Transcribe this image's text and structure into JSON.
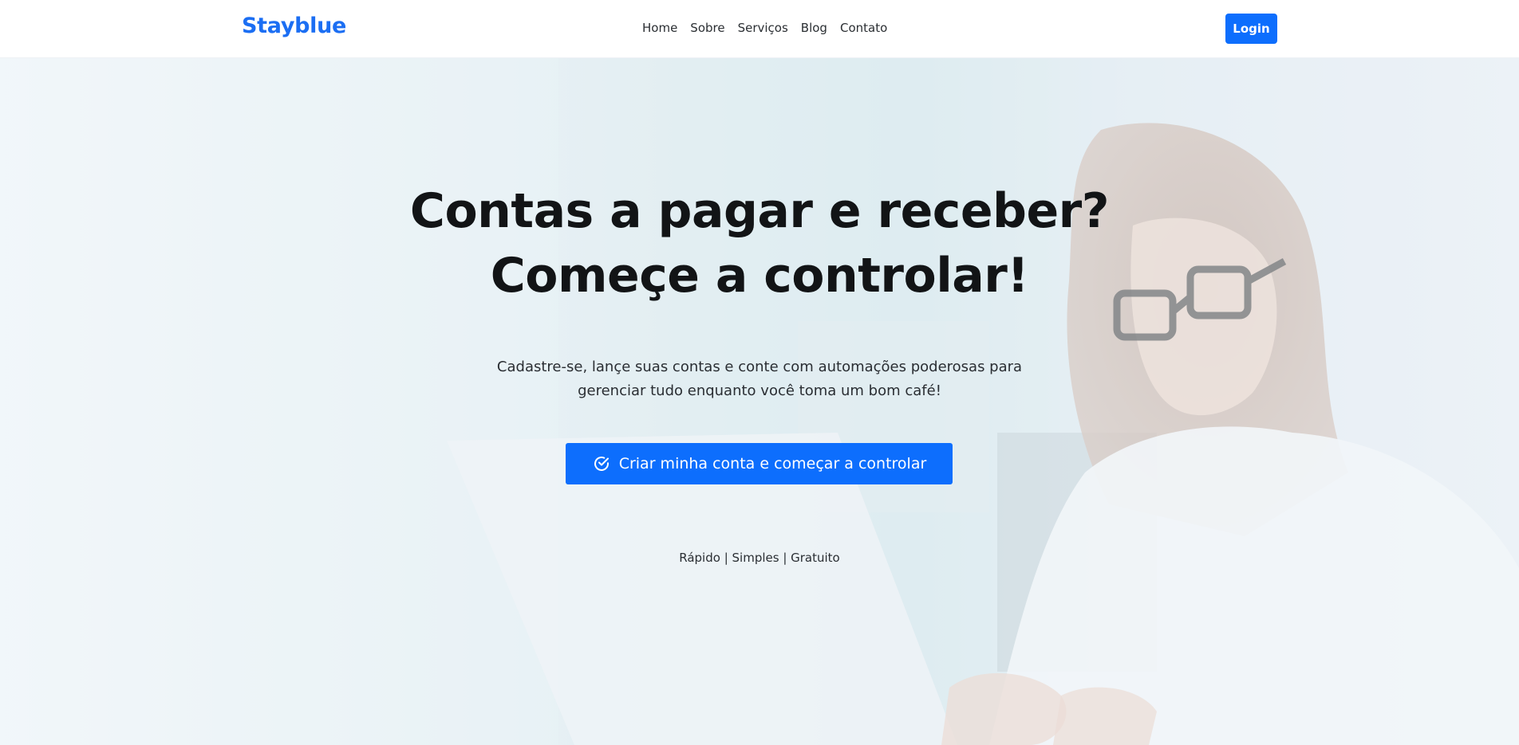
{
  "navbar": {
    "brand": "Stayblue",
    "links": [
      "Home",
      "Sobre",
      "Serviços",
      "Blog",
      "Contato"
    ],
    "login_label": "Login"
  },
  "hero": {
    "headline_line1": "Contas a pagar e receber?",
    "headline_line2": "Começe a controlar!",
    "subtitle_line1": "Cadastre-se, lançe suas contas e conte com automações poderosas para",
    "subtitle_line2": "gerenciar tudo enquanto você toma um bom café!",
    "cta_label": "Criar minha conta e começar a controlar",
    "cta_icon": "check-circle-icon",
    "tagline": "Rápido | Simples | Gratuito"
  },
  "colors": {
    "brand": "#1b6ef3",
    "primary_button": "#0d6efd",
    "headline": "#121416"
  }
}
